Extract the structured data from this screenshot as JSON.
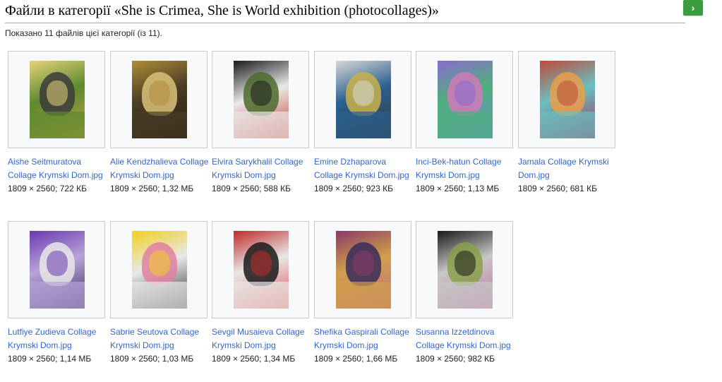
{
  "header": {
    "title": "Файли в категорії «She is Crimea, She is World exhibition (photocollages)»",
    "next_button": "›"
  },
  "summary": "Показано 11 файлів цієї категорії (із 11).",
  "files": [
    {
      "name": "Aishe Seitmuratova Collage Krymski Dom.jpg",
      "meta": "1809 × 2560; 722 КБ",
      "colors": [
        "#e8d27a",
        "#5c8a2e",
        "#3b3b3b",
        "#c9a24a"
      ]
    },
    {
      "name": "Alie Kendzhalieva Collage Krymski Dom.jpg",
      "meta": "1809 × 2560; 1,32 МБ",
      "colors": [
        "#b08d3a",
        "#4a3c24",
        "#d9c27a",
        "#1f1c16"
      ]
    },
    {
      "name": "Elvira Sarykhalil Collage Krymski Dom.jpg",
      "meta": "1809 × 2560; 588 КБ",
      "colors": [
        "#1b1b1b",
        "#e8e8e8",
        "#4b6b2b",
        "#c83a2a"
      ]
    },
    {
      "name": "Emine Dzhaparova Collage Krymski Dom.jpg",
      "meta": "1809 × 2560; 923 КБ",
      "colors": [
        "#d8d8d8",
        "#2a5f8f",
        "#c9b24a",
        "#3a3a3a"
      ]
    },
    {
      "name": "Inci-Bek-hatun Collage Krymski Dom.jpg",
      "meta": "1809 × 2560; 1,13 МБ",
      "colors": [
        "#8a6ad0",
        "#4fb07a",
        "#d07ab8",
        "#6a8ad8"
      ]
    },
    {
      "name": "Jamala Collage Krymski Dom.jpg",
      "meta": "1809 × 2560; 681 КБ",
      "colors": [
        "#c04a3a",
        "#6ac0c0",
        "#e8a04a",
        "#a02a5a"
      ]
    },
    {
      "name": "Lutfiye Zudieva Collage Krymski Dom.jpg",
      "meta": "1809 × 2560; 1,14 МБ",
      "colors": [
        "#6a3ab0",
        "#b8a4d8",
        "#e8e8e8",
        "#3a2a5a"
      ]
    },
    {
      "name": "Sabrie Seutova Collage Krymski Dom.jpg",
      "meta": "1809 × 2560; 1,03 МБ",
      "colors": [
        "#f0d020",
        "#e8e8e8",
        "#e080a0",
        "#2a2a2a"
      ]
    },
    {
      "name": "Sevgil Musaieva Collage Krymski Dom.jpg",
      "meta": "1809 × 2560; 1,34 МБ",
      "colors": [
        "#c02a2a",
        "#e8e8e8",
        "#1a1a1a",
        "#e04a4a"
      ]
    },
    {
      "name": "Shefika Gaspirali Collage Krymski Dom.jpg",
      "meta": "1809 × 2560; 1,66 МБ",
      "colors": [
        "#8a3a6a",
        "#d0a04a",
        "#3a2a5a",
        "#c06a8a"
      ]
    },
    {
      "name": "Susanna Izzetdinova Collage Krymski Dom.jpg",
      "meta": "1809 × 2560; 982 КБ",
      "colors": [
        "#1a1a1a",
        "#c8c8c8",
        "#8aa04a",
        "#c070a0"
      ]
    }
  ]
}
